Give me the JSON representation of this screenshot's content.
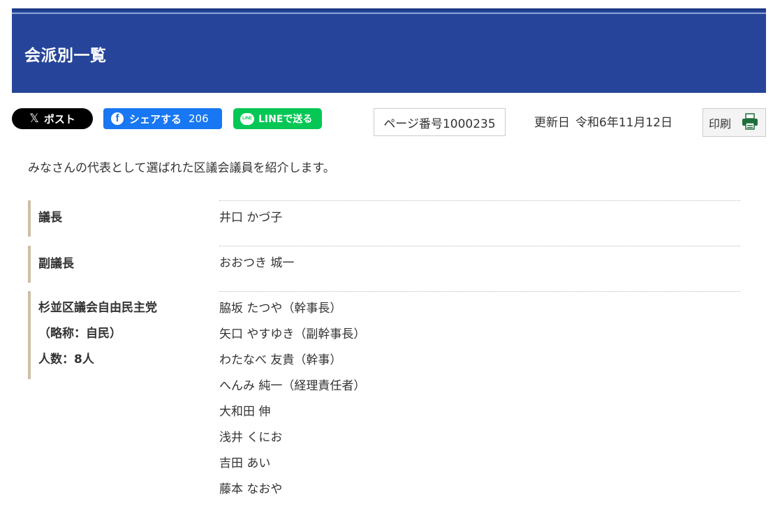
{
  "page": {
    "title": "会派別一覧"
  },
  "toolbar": {
    "x_post_label": "ポスト",
    "x_logo": "𝕏",
    "fb_label": "シェアする",
    "fb_logo": "f",
    "fb_count": "206",
    "line_label": "LINEで送る",
    "line_logo": "LINE",
    "page_number": "ページ番号1000235",
    "updated_label": "更新日",
    "updated_date": "令和6年11月12日",
    "print_label": "印刷",
    "print_icon": "printer-icon"
  },
  "intro": "みなさんの代表として選ばれた区議会議員を紹介します。",
  "members": {
    "chair": {
      "label": "議長",
      "name": "井口 かづ子"
    },
    "vice_chair": {
      "label": "副議長",
      "name": "おおつき 城一"
    },
    "ldp": {
      "label_line1": "杉並区議会自由民主党",
      "label_line2": "（略称：自民）",
      "label_line3": "人数：8人",
      "names": [
        "脇坂 たつや（幹事長）",
        "矢口 やすゆき（副幹事長）",
        "わたなべ 友貴（幹事）",
        "へんみ 純一（経理責任者）",
        "大和田 伸",
        "浅井 くにお",
        "吉田 あい",
        "藤本 なおや"
      ]
    }
  },
  "colors": {
    "header_bg": "#26459a",
    "fb_blue": "#1877f2",
    "line_green": "#06c755",
    "row_accent": "#cdbfa6",
    "printer_green": "#1e6e3c"
  }
}
